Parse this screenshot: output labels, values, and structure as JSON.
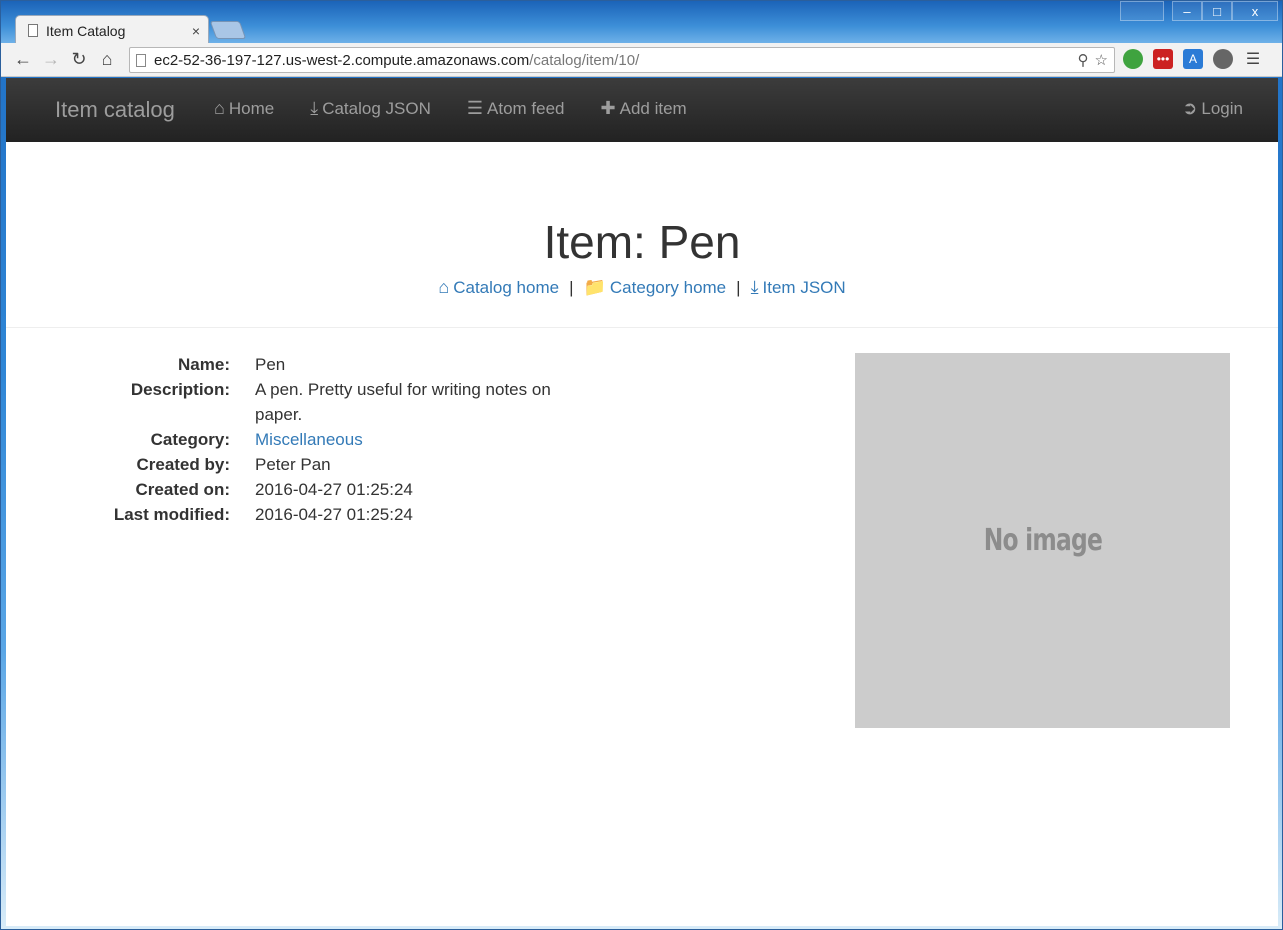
{
  "browser": {
    "tab_title": "Item Catalog",
    "tab_close": "×",
    "url_host": "ec2-52-36-197-127.us-west-2.compute.amazonaws.com",
    "url_path": "/catalog/item/10/",
    "window_controls": {
      "minimize": "–",
      "maximize": "□",
      "close": "x"
    }
  },
  "navbar": {
    "brand": "Item catalog",
    "links": [
      {
        "label": "Home",
        "icon": "home-icon"
      },
      {
        "label": "Catalog JSON",
        "icon": "download-icon"
      },
      {
        "label": "Atom feed",
        "icon": "list-icon"
      },
      {
        "label": "Add item",
        "icon": "plus-icon"
      }
    ],
    "login": {
      "label": "Login",
      "icon": "login-icon"
    }
  },
  "header": {
    "title": "Item: Pen",
    "crumbs": [
      {
        "label": "Catalog home",
        "icon": "home-icon"
      },
      {
        "label": "Category home",
        "icon": "folder-icon"
      },
      {
        "label": "Item JSON",
        "icon": "download-icon"
      }
    ],
    "separator": "|"
  },
  "details": [
    {
      "label": "Name:",
      "value": "Pen"
    },
    {
      "label": "Description:",
      "value": "A pen. Pretty useful for writing notes on paper."
    },
    {
      "label": "Category:",
      "value": "Miscellaneous"
    },
    {
      "label": "Created by:",
      "value": "Peter Pan"
    },
    {
      "label": "Created on:",
      "value": "2016-04-27 01:25:24"
    },
    {
      "label": "Last modified:",
      "value": "2016-04-27 01:25:24"
    }
  ],
  "image": {
    "placeholder_text": "No image"
  },
  "colors": {
    "link": "#337ab7",
    "navbar": "#222222",
    "image_bg": "#cccccc"
  }
}
